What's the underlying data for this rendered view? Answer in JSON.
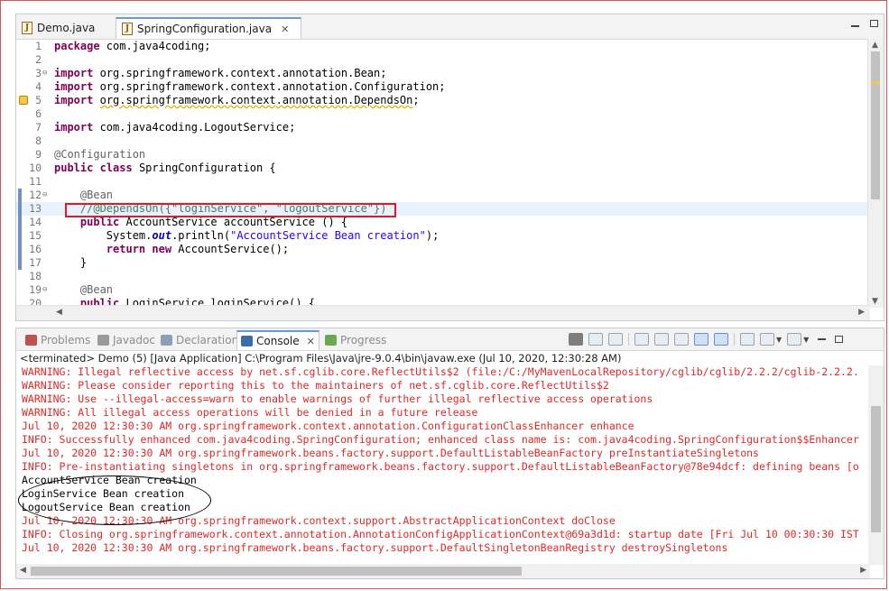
{
  "editor": {
    "tabs": [
      {
        "label": "Demo.java",
        "active": false
      },
      {
        "label": "SpringConfiguration.java",
        "active": true
      }
    ],
    "lines": [
      {
        "n": "1",
        "html": "<span class=\"kw\">package</span> com.java4coding;"
      },
      {
        "n": "2",
        "html": ""
      },
      {
        "n": "3",
        "html": "<span class=\"kw\">import</span> org.springframework.context.annotation.Bean;",
        "fold": true
      },
      {
        "n": "4",
        "html": "<span class=\"kw\">import</span> org.springframework.context.annotation.Configuration;"
      },
      {
        "n": "5",
        "html": "<span class=\"kw\">import</span> <span class=\"squig\">org.springframework.context.annotation.DependsOn</span>;",
        "warn": true
      },
      {
        "n": "6",
        "html": ""
      },
      {
        "n": "7",
        "html": "<span class=\"kw\">import</span> com.java4coding.LogoutService;"
      },
      {
        "n": "8",
        "html": ""
      },
      {
        "n": "9",
        "html": "<span class=\"ann\">@Configuration</span>"
      },
      {
        "n": "10",
        "html": "<span class=\"kw\">public</span> <span class=\"kw\">class</span> SpringConfiguration {"
      },
      {
        "n": "11",
        "html": ""
      },
      {
        "n": "12",
        "html": "    <span class=\"ann\">@Bean</span>",
        "fold": true,
        "mark": true
      },
      {
        "n": "13",
        "html": "    <span class=\"cmt\">//@DependsOn({\"loginService\", \"logoutService\"})</span>",
        "mark": true,
        "hl": true
      },
      {
        "n": "14",
        "html": "    <span class=\"kw\">public</span> AccountService accountService () {",
        "mark": true
      },
      {
        "n": "15",
        "html": "        System.<span class=\"stat\">out</span>.println(<span class=\"str\">\"AccountService Bean creation\"</span>);",
        "mark": true
      },
      {
        "n": "16",
        "html": "        <span class=\"kw\">return</span> <span class=\"kw\">new</span> AccountService();",
        "mark": true
      },
      {
        "n": "17",
        "html": "    }",
        "mark": true
      },
      {
        "n": "18",
        "html": ""
      },
      {
        "n": "19",
        "html": "    <span class=\"ann\">@Bean</span>",
        "fold": true
      },
      {
        "n": "20",
        "html": "    <span class=\"kw\">public</span> LoginService loginService() {"
      }
    ]
  },
  "console": {
    "tabs": [
      {
        "label": "Problems",
        "name": "tab-problems",
        "icon": "problems-icon",
        "color": "#c0504d",
        "active": false
      },
      {
        "label": "Javadoc",
        "name": "tab-javadoc",
        "icon": "javadoc-icon",
        "color": "#9a9a9a",
        "active": false
      },
      {
        "label": "Declaration",
        "name": "tab-declaration",
        "icon": "declaration-icon",
        "color": "#8aa0b8",
        "active": false
      },
      {
        "label": "Console",
        "name": "tab-console",
        "icon": "console-icon",
        "color": "#3a6ea5",
        "active": true
      },
      {
        "label": "Progress",
        "name": "tab-progress",
        "icon": "progress-icon",
        "color": "#6aa84f",
        "active": false
      }
    ],
    "terminated": "<terminated> Demo (5) [Java Application] C:\\Program Files\\Java\\jre-9.0.4\\bin\\javaw.exe (Jul 10, 2020, 12:30:28 AM)",
    "output": [
      {
        "text": "WARNING: Illegal reflective access by net.sf.cglib.core.ReflectUtils$2 (file:/C:/MyMavenLocalRepository/cglib/cglib/2.2.2/cglib-2.2.2.",
        "color": "red"
      },
      {
        "text": "WARNING: Please consider reporting this to the maintainers of net.sf.cglib.core.ReflectUtils$2",
        "color": "red"
      },
      {
        "text": "WARNING: Use --illegal-access=warn to enable warnings of further illegal reflective access operations",
        "color": "red"
      },
      {
        "text": "WARNING: All illegal access operations will be denied in a future release",
        "color": "red"
      },
      {
        "text": "Jul 10, 2020 12:30:30 AM org.springframework.context.annotation.ConfigurationClassEnhancer enhance",
        "color": "red"
      },
      {
        "text": "INFO: Successfully enhanced com.java4coding.SpringConfiguration; enhanced class name is: com.java4coding.SpringConfiguration$$Enhancer",
        "color": "red"
      },
      {
        "text": "Jul 10, 2020 12:30:30 AM org.springframework.beans.factory.support.DefaultListableBeanFactory preInstantiateSingletons",
        "color": "red"
      },
      {
        "text": "INFO: Pre-instantiating singletons in org.springframework.beans.factory.support.DefaultListableBeanFactory@78e94dcf: defining beans [o",
        "color": "red"
      },
      {
        "text": "AccountService Bean creation",
        "color": "black"
      },
      {
        "text": "LoginService Bean creation",
        "color": "black"
      },
      {
        "text": "LogoutService Bean creation",
        "color": "black"
      },
      {
        "text": "Jul 10, 2020 12:30:30 AM org.springframework.context.support.AbstractApplicationContext doClose",
        "color": "red"
      },
      {
        "text": "INFO: Closing org.springframework.context.annotation.AnnotationConfigApplicationContext@69a3d1d: startup date [Fri Jul 10 00:30:30 IST",
        "color": "red"
      },
      {
        "text": "Jul 10, 2020 12:30:30 AM org.springframework.beans.factory.support.DefaultSingletonBeanRegistry destroySingletons",
        "color": "red"
      }
    ]
  },
  "colors": {
    "accent": "#6b9bd2",
    "console_error": "#e02828",
    "highlight_box": "#e01b24"
  }
}
